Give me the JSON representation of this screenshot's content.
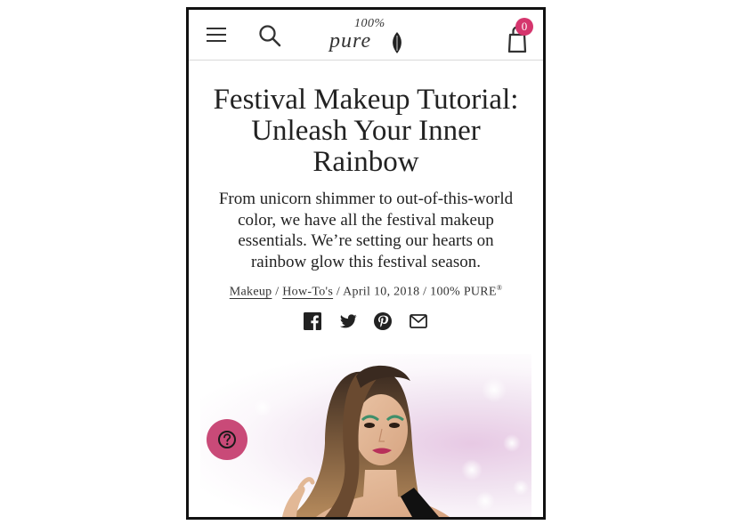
{
  "header": {
    "menu_icon": "hamburger-menu-icon",
    "search_icon": "search-icon",
    "logo": {
      "percent": "100%",
      "word": "pure"
    },
    "cart": {
      "icon": "shopping-bag-icon",
      "count": "0",
      "badge_color": "#d5356d"
    }
  },
  "article": {
    "title": "Festival Makeup Tutorial: Unleash Your Inner Rainbow",
    "subtitle": "From unicorn shimmer to out-of-this-world color, we have all the festival makeup essentials. We’re setting our hearts on rainbow glow this festival season.",
    "meta": {
      "category_1": "Makeup",
      "sep_1": " / ",
      "category_2": "How-To's",
      "sep_2": " / April 10, 2018 / 100% PURE",
      "reg": "®"
    },
    "share": [
      "facebook-icon",
      "twitter-icon",
      "pinterest-icon",
      "email-icon"
    ]
  },
  "hero": {
    "description": "woman-with-festival-makeup-photo"
  },
  "help_button": {
    "icon": "question-mark-icon",
    "color": "#c94a78"
  }
}
